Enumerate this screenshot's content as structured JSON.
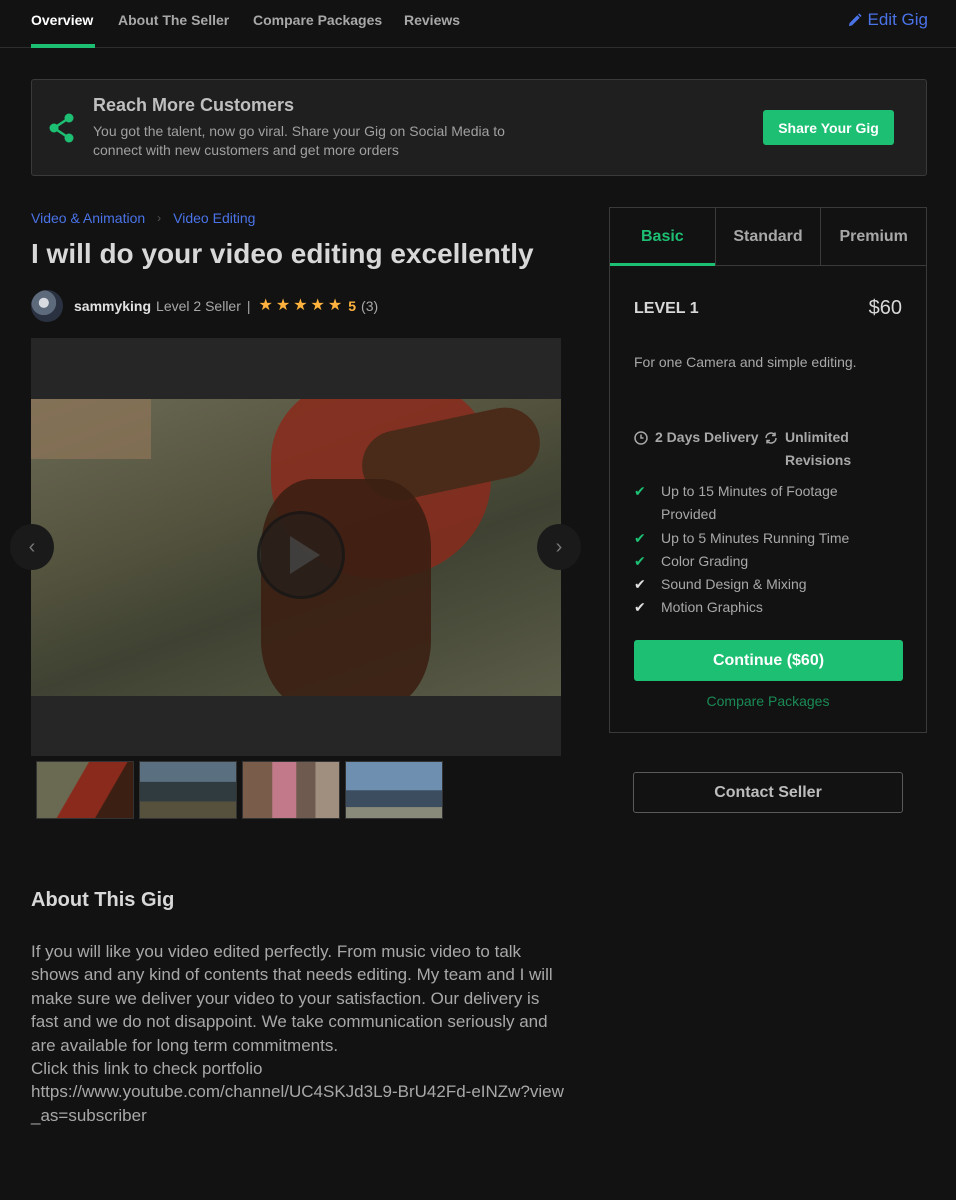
{
  "nav": {
    "tabs": [
      "Overview",
      "About The Seller",
      "Compare Packages",
      "Reviews"
    ],
    "active": "Overview",
    "edit_label": "Edit Gig"
  },
  "banner": {
    "title": "Reach More Customers",
    "text": "You got the talent, now go viral. Share your Gig on Social Media to connect with new customers and get more orders",
    "button": "Share Your Gig",
    "icon": "share-icon"
  },
  "breadcrumb": [
    "Video & Animation",
    "Video Editing"
  ],
  "gig": {
    "title": "I will do your video editing excellently",
    "seller": "sammyking",
    "level": "Level 2 Seller",
    "separator": "|",
    "stars": 5,
    "rating": "5",
    "review_count": "(3)"
  },
  "gallery": {
    "thumbnail_count": 4
  },
  "about": {
    "title": "About This Gig",
    "paragraphs": [
      "If you will like you video edited perfectly. From music video to talk shows and any kind of contents that needs editing. My team and I will make sure we deliver your video to your satisfaction. Our delivery is fast and we do not disappoint. We take communication seriously and are available for long term commitments.",
      "Click this link to check portfolio",
      "https://www.youtube.com/channel/UC4SKJd3L9-BrU42Fd-eINZw?view_as=subscriber"
    ]
  },
  "package": {
    "tabs": [
      "Basic",
      "Standard",
      "Premium"
    ],
    "active_tab": "Basic",
    "level": "LEVEL 1",
    "price": "$60",
    "description": "For one Camera and simple editing.",
    "delivery": "2 Days Delivery",
    "revisions": "Unlimited Revisions",
    "features": [
      {
        "text": "Up to 15 Minutes of Footage Provided",
        "included": true
      },
      {
        "text": "Up to 5 Minutes Running Time",
        "included": true
      },
      {
        "text": "Color Grading",
        "included": true
      },
      {
        "text": "Sound Design & Mixing",
        "included": false
      },
      {
        "text": "Motion Graphics",
        "included": false
      }
    ],
    "continue_label": "Continue ($60)",
    "compare_label": "Compare Packages"
  },
  "contact_label": "Contact Seller",
  "colors": {
    "accent": "#1dbf73",
    "link": "#4a73e8",
    "star": "#ffb33e",
    "background": "#121212"
  }
}
